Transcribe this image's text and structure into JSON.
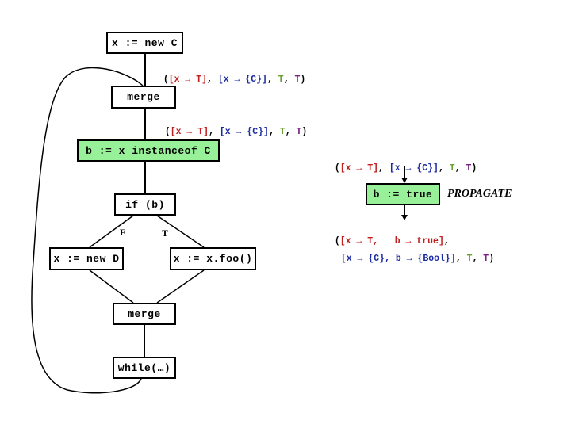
{
  "colors": {
    "highlight_fill": "#98f098",
    "state_red": "#c02020",
    "state_blue": "#1a2aa0",
    "state_green": "#6aa030",
    "state_purple": "#7a2080"
  },
  "nodes": {
    "new_c": "x := new C",
    "merge_top": "merge",
    "instanceof": "b := x instanceof C",
    "if_b": "if (b)",
    "new_d": "x := new D",
    "foo": "x := x.foo()",
    "merge_bottom": "merge",
    "while": "while(…)",
    "b_true": "b := true"
  },
  "edge_labels": {
    "false_branch": "F",
    "true_branch": "T"
  },
  "annotation": "PROPAGATE",
  "states": {
    "after_new_c": {
      "open": "(",
      "p1": "[x → T]",
      "sep1": ", ",
      "p2": "[x → {C}]",
      "sep2": ", ",
      "p3": "T",
      "sep3": ", ",
      "p4": "T",
      "close": ")"
    },
    "after_merge": {
      "open": "(",
      "p1": "[x → T]",
      "sep1": ", ",
      "p2": "[x → {C}]",
      "sep2": ", ",
      "p3": "T",
      "sep3": ", ",
      "p4": "T",
      "close": ")"
    },
    "before_propagate": {
      "open": "(",
      "p1": "[x → T]",
      "sep1": ", ",
      "p2": "[x → {C}]",
      "sep2": ", ",
      "p3": "T",
      "sep3": ", ",
      "p4": "T",
      "close": ")"
    },
    "after_propagate": {
      "line1_open": "(",
      "line1_p1": "[x → T,   b → true]",
      "line1_sep": ",",
      "line2_p2": "[x → {C}, b → {Bool}]",
      "line2_sep2": ", ",
      "line2_p3": "T",
      "line2_sep3": ", ",
      "line2_p4": "T",
      "line2_close": ")"
    }
  }
}
